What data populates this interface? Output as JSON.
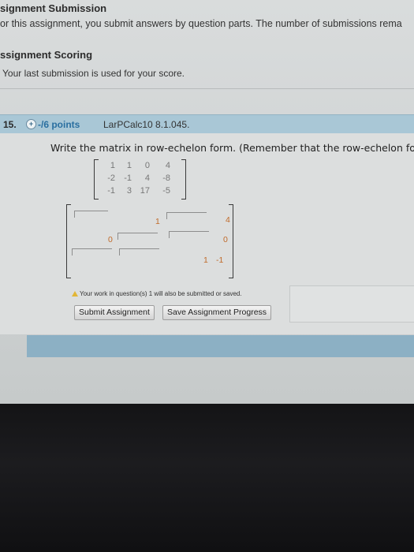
{
  "header": {
    "title": "signment Submission",
    "desc": "or this assignment, you submit answers by question parts. The number of submissions rema",
    "scoring_title": "ssignment Scoring",
    "scoring_desc": "Your last submission is used for your score."
  },
  "question": {
    "number": "15.",
    "plus": "+",
    "points": "-/6 points",
    "source": "LarPCalc10 8.1.045.",
    "prompt": "Write the matrix in row-echelon form. (Remember that the row-echelon for",
    "matrix": [
      [
        "1",
        "1",
        "0",
        "4"
      ],
      [
        "-2",
        "-1",
        "4",
        "-8"
      ],
      [
        "-1",
        "3",
        "17",
        "-5"
      ]
    ],
    "answer_values": [
      "1",
      "4",
      "0",
      "0",
      "1",
      "-1"
    ]
  },
  "notice": "Your work in question(s) 1 will also be submitted or saved.",
  "buttons": {
    "submit": "Submit Assignment",
    "save": "Save Assignment Progress"
  },
  "colors": {
    "question_bar": "#a9c7d6",
    "footer_bar": "#8cb0c4",
    "points_link": "#2a6fa0"
  }
}
